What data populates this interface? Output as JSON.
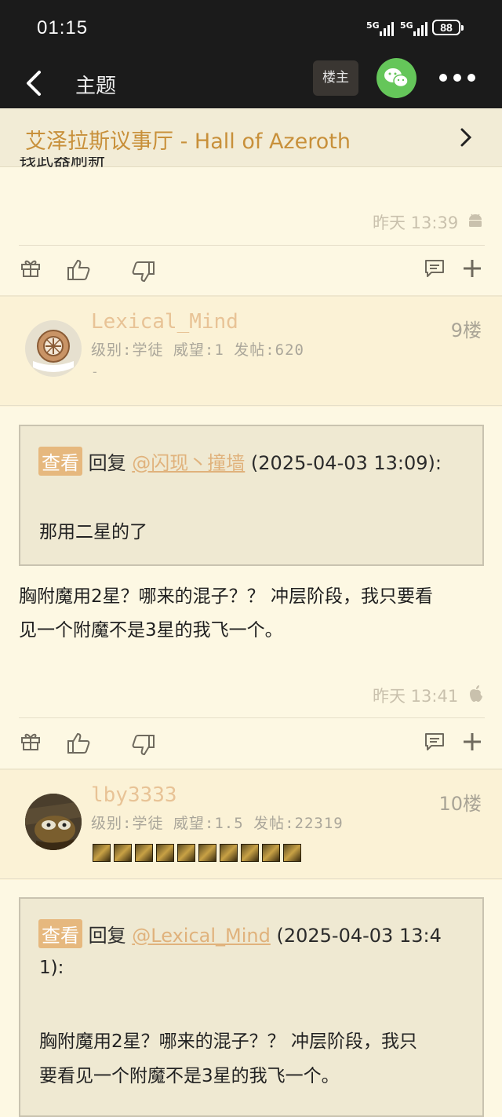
{
  "status_bar": {
    "time": "01:15",
    "signal_1": "5G",
    "signal_2": "5G",
    "battery": "88"
  },
  "nav": {
    "title": "主题",
    "op_button": "楼主",
    "icons": [
      "back-icon",
      "wechat-icon",
      "more-icon"
    ]
  },
  "forum": {
    "name": "艾泽拉斯议事厅 - Hall of Azeroth"
  },
  "posts": [
    {
      "time": "昨天 13:39",
      "device_icon": "android-icon"
    },
    {
      "username": "Lexical_Mind",
      "info": "级别:学徒 威望:1 发帖:620",
      "signature": "-",
      "floor": "9楼",
      "quote": {
        "badge": "查看",
        "prefix": "回复",
        "mention": "@闪现丶撞墙",
        "datetime": "(2025-04-03 13:09):",
        "text": "那用二星的了"
      },
      "body_line1": "胸附魔用2星？哪来的混子？？ 冲层阶段，我只要看",
      "body_line2": "见一个附魔不是3星的我飞一个。",
      "time": "昨天 13:41",
      "device_icon": "apple-icon"
    },
    {
      "username": "lby3333",
      "info": "级别:学徒 威望:1.5 发帖:22319",
      "floor": "10楼",
      "badge_count": 10,
      "quote": {
        "badge": "查看",
        "prefix": "回复",
        "mention": "@Lexical_Mind",
        "datetime": "(2025-04-03 13:4",
        "datetime_cont": "1):",
        "text_line1": "胸附魔用2星？哪来的混子？？ 冲层阶段，我只",
        "text_line2": "要看见一个附魔不是3星的我飞一个。"
      }
    }
  ],
  "colors": {
    "background": "#fdf8e3",
    "accent": "#c8903a",
    "username": "#e8c396",
    "bar": "#1b1b1b"
  }
}
